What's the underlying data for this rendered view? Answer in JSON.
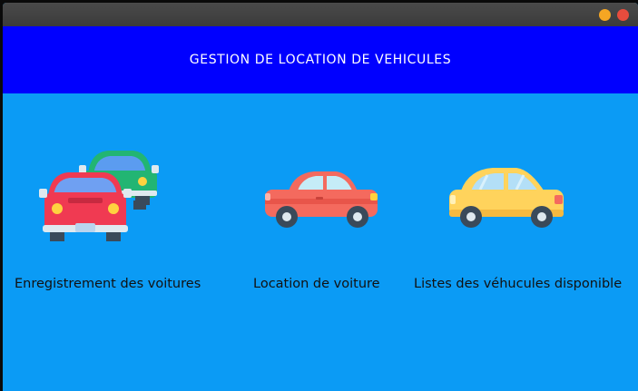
{
  "window": {
    "controls": [
      {
        "name": "minimize",
        "color": "#f5a623"
      },
      {
        "name": "close",
        "color": "#e84c3d"
      }
    ]
  },
  "header": {
    "title": "GESTION DE LOCATION DE VEHICULES",
    "background": "#0000ff"
  },
  "main": {
    "background": "#0b9bf5",
    "options": [
      {
        "label": "Enregistrement des voitures",
        "icon": "two-cars-icon"
      },
      {
        "label": "Location de voiture",
        "icon": "red-car-icon"
      },
      {
        "label": "Listes des véhucules disponible",
        "icon": "yellow-car-icon"
      }
    ]
  }
}
